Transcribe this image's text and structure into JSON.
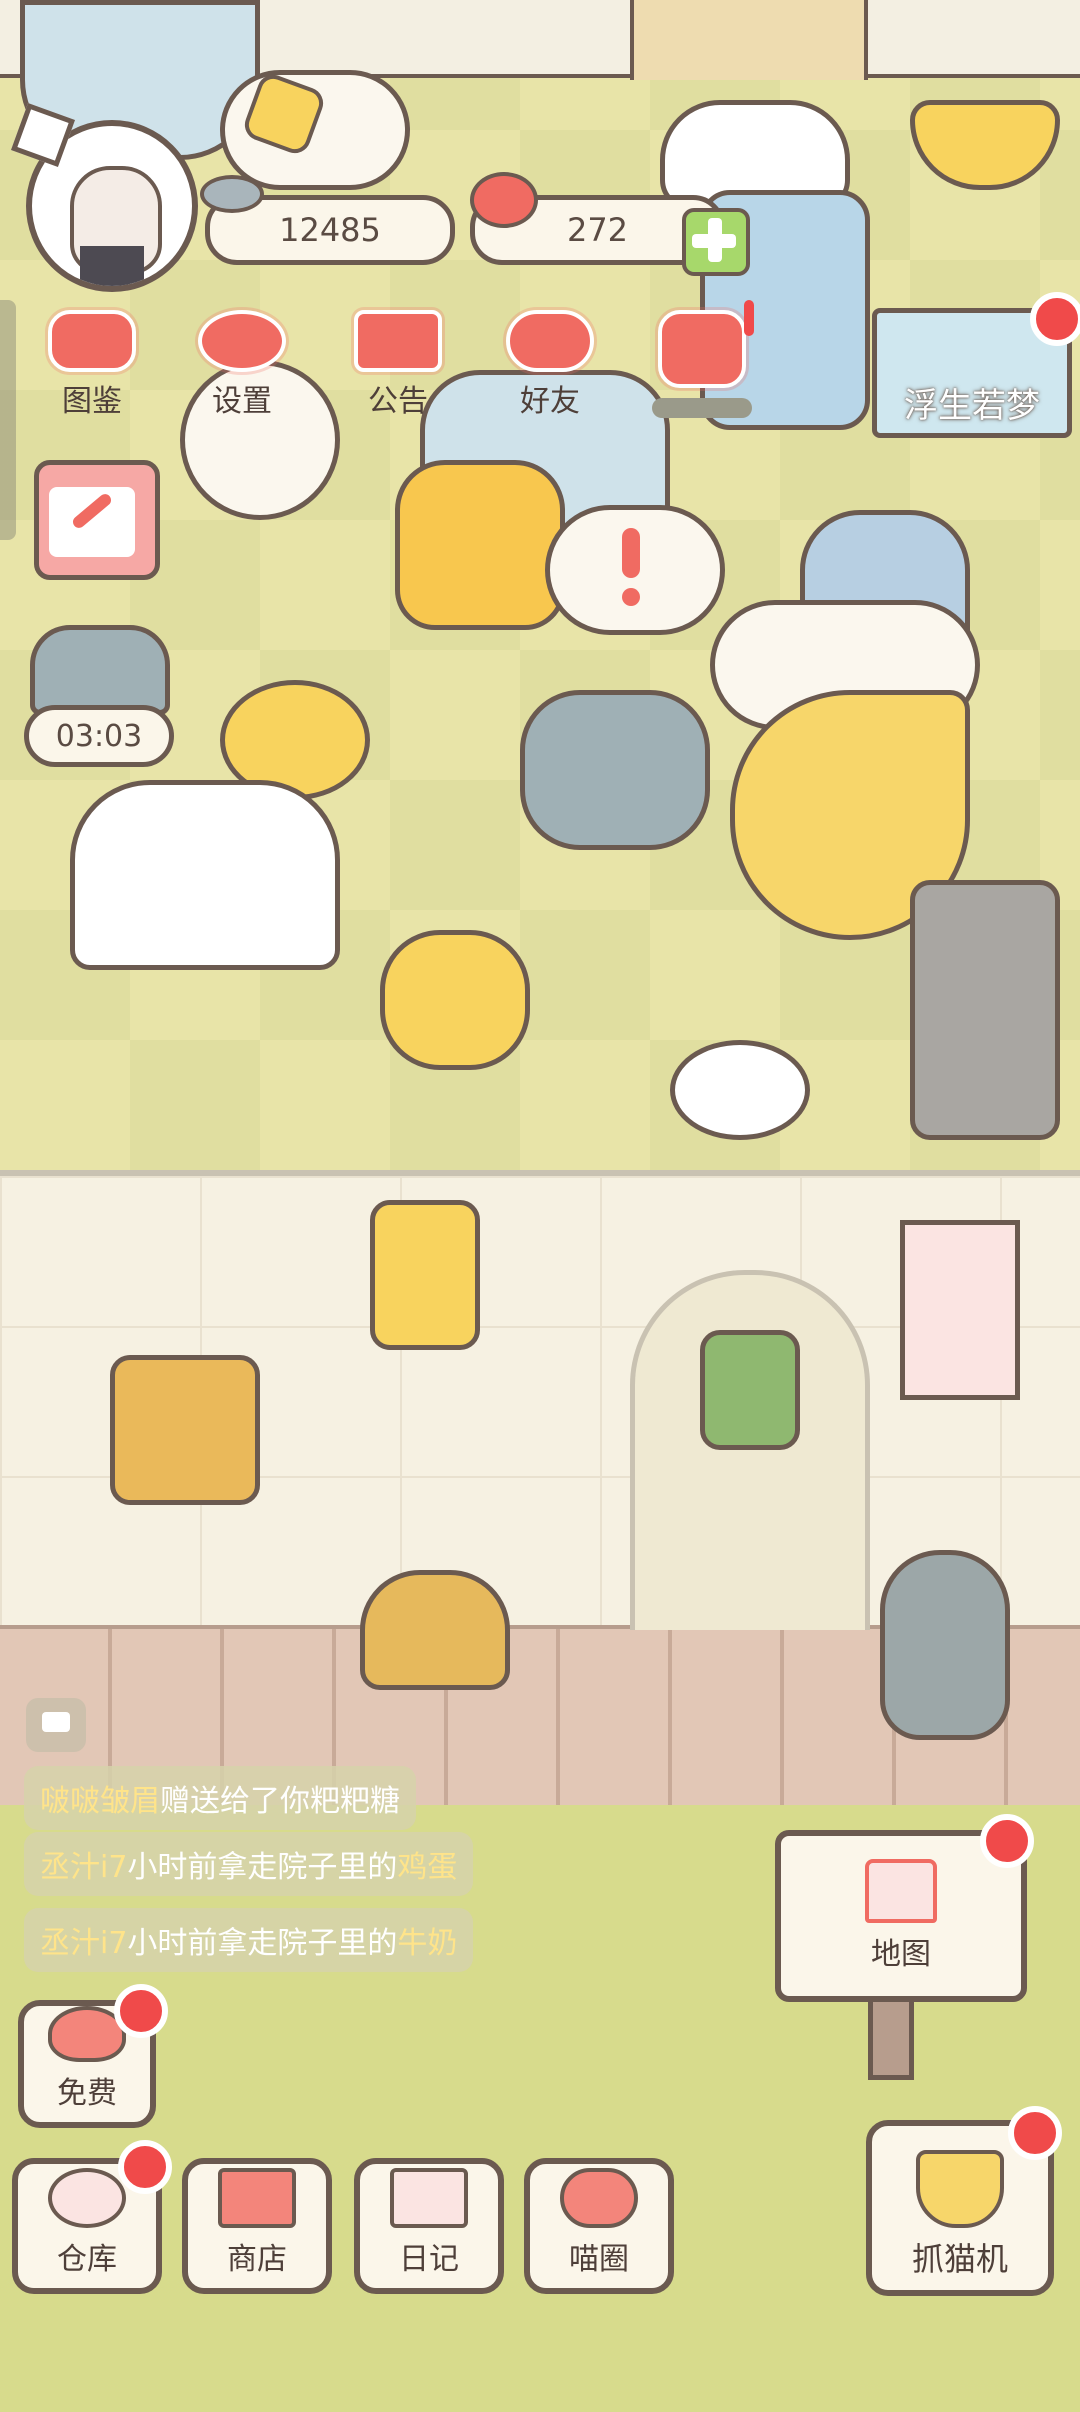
{
  "currency": {
    "fish": "12485",
    "hearts": "272"
  },
  "top_menu": [
    {
      "label": "图鉴",
      "icon": "cat-face-icon"
    },
    {
      "label": "设置",
      "icon": "gear-icon"
    },
    {
      "label": "公告",
      "icon": "gift-icon"
    },
    {
      "label": "好友",
      "icon": "friends-icon"
    },
    {
      "label": "",
      "icon": "heart-exclaim-icon"
    }
  ],
  "event_banner": {
    "label": "浮生若梦"
  },
  "timer": {
    "value": "03:03"
  },
  "messages": [
    {
      "name": "啵啵皱眉",
      "text": "赠送给了你粑粑糖",
      "item": ""
    },
    {
      "name": "丞汁i7",
      "text": "小时前拿走院子里的",
      "item": "鸡蛋"
    },
    {
      "name": "丞汁i7",
      "text": "小时前拿走院子里的",
      "item": "牛奶"
    }
  ],
  "buttons": {
    "free": "免费",
    "map": "地图",
    "warehouse": "仓库",
    "shop": "商店",
    "diary": "日记",
    "cat_circle": "喵圈",
    "claw": "抓猫机"
  },
  "colors": {
    "accent": "#f06b62",
    "badge": "#f04a4a",
    "outline": "#6b5a50",
    "highlight": "#ffe48a"
  }
}
